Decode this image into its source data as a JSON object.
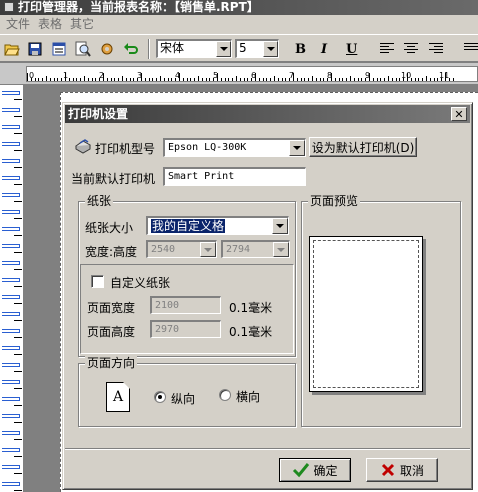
{
  "app": {
    "title": "打印管理器，当前报表名称：【销售单.RPT】"
  },
  "menubar": {
    "items": [
      "文件",
      "表格",
      "其它"
    ]
  },
  "toolbar": {
    "font_name": "宋体",
    "font_size": "5",
    "bold": "B",
    "italic": "I",
    "underline": "U"
  },
  "ruler": {
    "labels": [
      "0",
      "1",
      "2",
      "3",
      "4",
      "5",
      "6",
      "7",
      "8",
      "9",
      "10",
      "11"
    ]
  },
  "dialog": {
    "title": "打印机设置",
    "close_glyph": "✕",
    "printer_model_label": "打印机型号",
    "printer_model_value": "Epson LQ-300K",
    "set_default_button": "设为默认打印机(D)",
    "current_default_label": "当前默认打印机",
    "current_default_value": "Smart Print",
    "paper_group": {
      "title": "纸张",
      "size_label": "纸张大小",
      "size_value": "我的自定义格",
      "wh_label": "宽度:高度",
      "width_value": "2540",
      "height_value": "2794",
      "custom_label": "自定义纸张",
      "custom_checked": false,
      "page_width_label": "页面宽度",
      "page_width_value": "2100",
      "page_width_unit": "0.1毫米",
      "page_height_label": "页面高度",
      "page_height_value": "2970",
      "page_height_unit": "0.1毫米"
    },
    "orientation_group": {
      "title": "页面方向",
      "icon_letter": "A",
      "portrait_label": "纵向",
      "landscape_label": "横向",
      "selected": "portrait"
    },
    "preview_group": {
      "title": "页面预览"
    },
    "ok_button": "确定",
    "cancel_button": "取消"
  },
  "colors": {
    "face": "#d4d0c8",
    "title_dark": "#3a3a3a",
    "selection": "#0a246a",
    "ok_check": "#1f8a1f",
    "cancel_x": "#c00000"
  }
}
